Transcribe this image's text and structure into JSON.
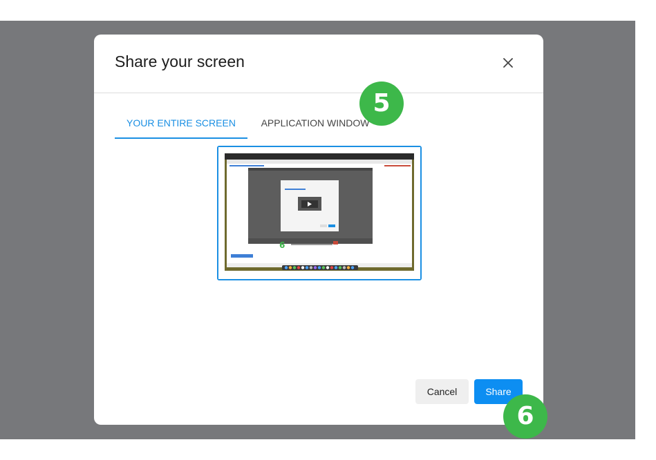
{
  "dialog": {
    "title": "Share your screen",
    "close_icon": "close-icon"
  },
  "tabs": [
    {
      "label": "YOUR ENTIRE SCREEN",
      "active": true
    },
    {
      "label": "APPLICATION WINDOW",
      "active": false
    }
  ],
  "preview": {
    "icon": "screen-thumbnail",
    "selected": true
  },
  "buttons": {
    "cancel_label": "Cancel",
    "share_label": "Share"
  },
  "annotations": {
    "step_5": "5",
    "step_6": "6"
  },
  "colors": {
    "accent": "#1a8fe3",
    "share_button": "#0d8ef2",
    "backdrop": "#77787b",
    "badge": "#3db84a"
  }
}
